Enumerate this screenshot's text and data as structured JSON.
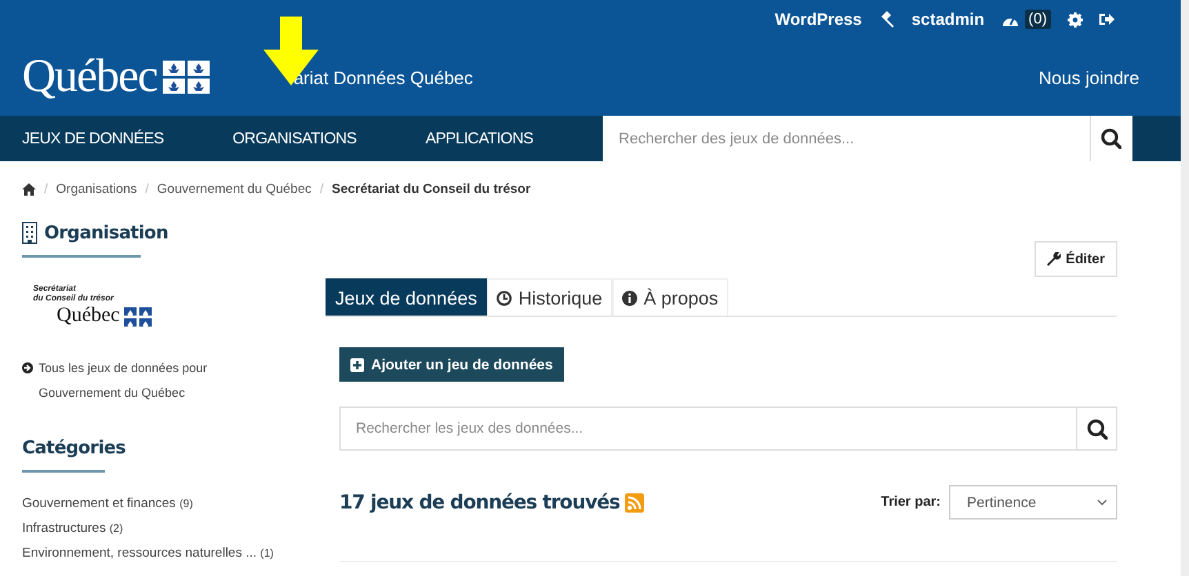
{
  "user_menu": {
    "wordpress": "WordPress",
    "username": "sctadmin",
    "notifications": "(0)"
  },
  "header": {
    "logo": "Québec",
    "site_title": "ariat Données Québec",
    "contact": "Nous joindre"
  },
  "nav": {
    "items": [
      {
        "label": "JEUX DE DONNÉES"
      },
      {
        "label": "ORGANISATIONS"
      },
      {
        "label": "APPLICATIONS"
      }
    ],
    "search": {
      "placeholder": "Rechercher des jeux de données..."
    }
  },
  "breadcrumb": [
    {
      "separator": "/",
      "label": "Organisations",
      "current": false
    },
    {
      "separator": "/",
      "label": "Gouvernement du Québec",
      "current": false
    },
    {
      "separator": "/",
      "label": "Secrétariat du Conseil du trésor",
      "current": true
    }
  ],
  "sidebar": {
    "heading": "Organisation",
    "org_logo": {
      "line1": "Secrétariat",
      "line2": "du Conseil du trésor",
      "wordmark": "Québec"
    },
    "parent_link": "Tous les jeux de données pour Gouvernement du Québec",
    "categories_heading": "Catégories",
    "categories": [
      {
        "label": "Gouvernement et finances",
        "count": "(9)"
      },
      {
        "label": "Infrastructures",
        "count": "(2)"
      },
      {
        "label": "Environnement, ressources naturelles ...",
        "count": "(1)"
      }
    ]
  },
  "main": {
    "edit_button": "Éditer",
    "tabs": [
      {
        "kind": "plain",
        "label": "Jeux de données",
        "selected": true
      },
      {
        "kind": "history",
        "label": "Historique",
        "selected": false
      },
      {
        "kind": "info",
        "label": "À propos",
        "selected": false
      }
    ],
    "add_button": "Ajouter un jeu de données",
    "search": {
      "placeholder": "Rechercher les jeux des données..."
    },
    "results_title": "17 jeux de données trouvés",
    "sort": {
      "label": "Trier par:",
      "value": "Pertinence"
    }
  }
}
